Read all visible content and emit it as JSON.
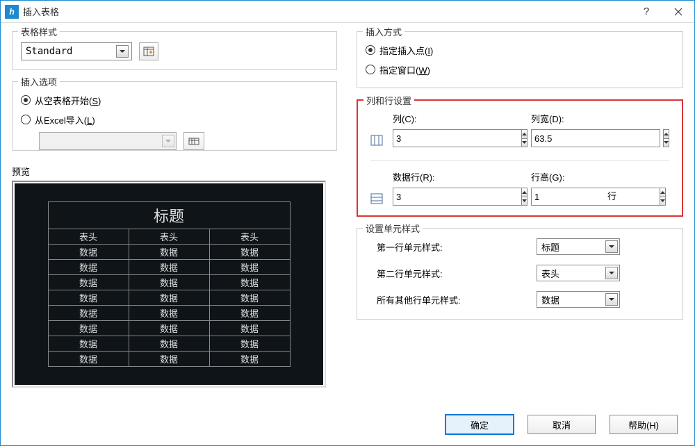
{
  "window": {
    "title": "插入表格"
  },
  "tableStyle": {
    "legend": "表格样式",
    "selected": "Standard"
  },
  "insertOptions": {
    "legend": "插入选项",
    "fromEmpty": "从空表格开始(",
    "fromEmptyKey": "S",
    "fromEmptyEnd": ")",
    "fromExcel": "从Excel导入(",
    "fromExcelKey": "L",
    "fromExcelEnd": ")"
  },
  "preview": {
    "label": "预览",
    "title": "标题",
    "header": "表头",
    "data": "数据"
  },
  "insertMode": {
    "legend": "插入方式",
    "point": "指定插入点(",
    "pointKey": "I",
    "pointEnd": ")",
    "window": "指定窗口(",
    "windowKey": "W",
    "windowEnd": ")"
  },
  "colRow": {
    "legend": "列和行设置",
    "colsLabel": "列(C):",
    "cols": "3",
    "colWidthLabel": "列宽(D):",
    "colWidth": "63.5",
    "dataRowsLabel": "数据行(R):",
    "dataRows": "3",
    "rowHeightLabel": "行高(G):",
    "rowHeight": "1",
    "rowSuffix": "行"
  },
  "cellStyle": {
    "legend": "设置单元样式",
    "row1": "第一行单元样式:",
    "row1val": "标题",
    "row2": "第二行单元样式:",
    "row2val": "表头",
    "rest": "所有其他行单元样式:",
    "restval": "数据"
  },
  "buttons": {
    "ok": "确定",
    "cancel": "取消",
    "help": "帮助(H)"
  }
}
